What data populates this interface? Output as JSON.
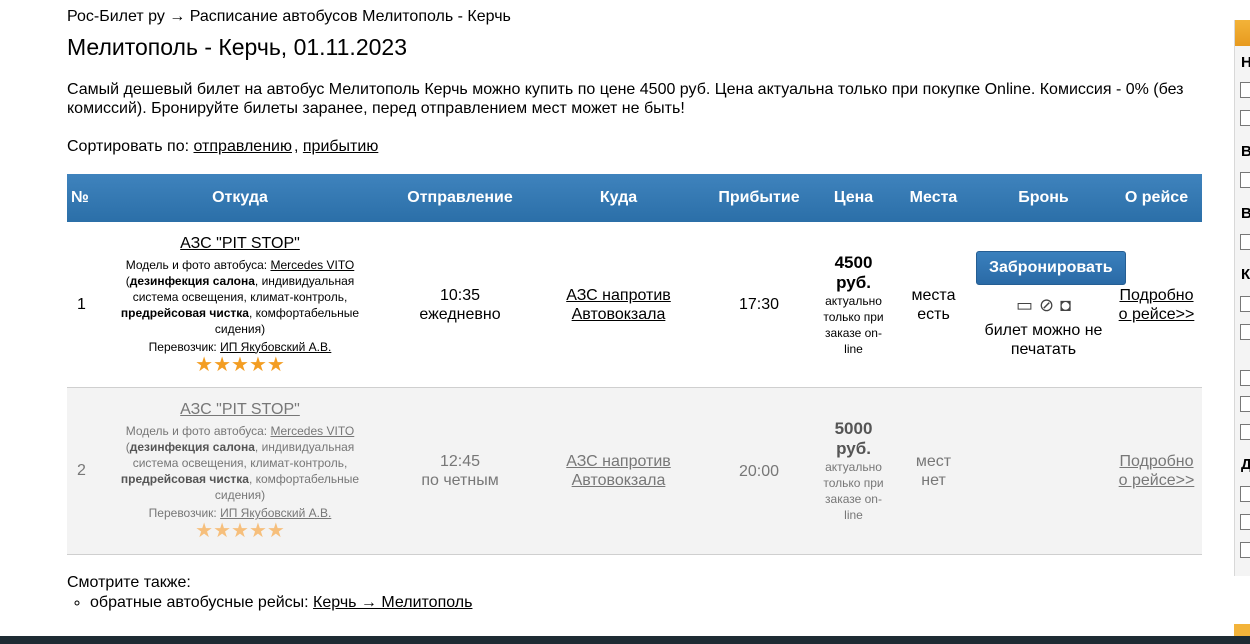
{
  "breadcrumb": "Рос-Билет ру → Расписание автобусов Мелитополь - Керчь",
  "title": "Мелитополь - Керчь, 01.11.2023",
  "intro": "Самый дешевый билет на автобус Мелитополь Керчь можно купить по цене 4500 руб. Цена актуальна только при покупке Online. Комиссия - 0% (без комиссий). Бронируйте билеты заранее, перед отправлением мест может не быть!",
  "sort": {
    "label": "Сортировать по:",
    "by_departure": "отправлению",
    "separator": ",",
    "by_arrival": "прибытию"
  },
  "table": {
    "headers": {
      "num": "№",
      "from": "Откуда",
      "departure": "Отправление",
      "to": "Куда",
      "arrival": "Прибытие",
      "price": "Цена",
      "seats": "Места",
      "booking": "Бронь",
      "about": "О рейсе"
    },
    "rows": [
      {
        "num": "1",
        "from_stop": "АЗС \"PIT STOP\"",
        "bus_label": "Модель и фото автобуса: ",
        "bus_model": "Mercedes VITO",
        "feat_open": "(",
        "feat_1": "дезинфекция салона",
        "feat_2": ", индивидуальная система освещения, климат-контроль, ",
        "feat_3": "предрейсовая чистка",
        "feat_4": ", комфортабельные сидения)",
        "carrier_label": "Перевозчик: ",
        "carrier": "ИП Якубовский А.В.",
        "rating": 5,
        "dep_time": "10:35",
        "dep_days": "ежедневно",
        "to_stop_1": "АЗС напротив",
        "to_stop_2": "Автовокзала",
        "arr_time": "17:30",
        "price": "4500 руб.",
        "price_note_1": "актуально",
        "price_note_2": "только при",
        "price_note_3": "заказе on-line",
        "seats_1": "места",
        "seats_2": "есть",
        "book_button": "Забронировать",
        "ticket_note_1": "билет можно не",
        "ticket_note_2": "печатать",
        "about_1": "Подробно",
        "about_2": "о рейсе>>"
      },
      {
        "num": "2",
        "from_stop": "АЗС \"PIT STOP\"",
        "bus_label": "Модель и фото автобуса: ",
        "bus_model": "Mercedes VITO",
        "feat_open": "(",
        "feat_1": "дезинфекция салона",
        "feat_2": ", индивидуальная система освещения, климат-контроль, ",
        "feat_3": "предрейсовая чистка",
        "feat_4": ", комфортабельные сидения)",
        "carrier_label": "Перевозчик: ",
        "carrier": "ИП Якубовский А.В.",
        "rating": 5,
        "dep_time": "12:45",
        "dep_days": "по четным",
        "to_stop_1": "АЗС напротив",
        "to_stop_2": "Автовокзала",
        "arr_time": "20:00",
        "price": "5000 руб.",
        "price_note_1": "актуально",
        "price_note_2": "только при",
        "price_note_3": "заказе on-line",
        "seats_1": "мест",
        "seats_2": "нет",
        "about_1": "Подробно",
        "about_2": "о рейсе>>"
      }
    ]
  },
  "see_also": {
    "label": "Смотрите также:",
    "item_label": "обратные автобусные рейсы: ",
    "item_link": "Керчь → Мелитополь"
  },
  "sidebar_letters": [
    "Н",
    "В",
    "В",
    "К",
    "Д"
  ],
  "colors": {
    "header_blue": "#3379b5",
    "star": "#f39d22",
    "footer": "#1e2b33",
    "accent_orange": "#f3b339"
  }
}
